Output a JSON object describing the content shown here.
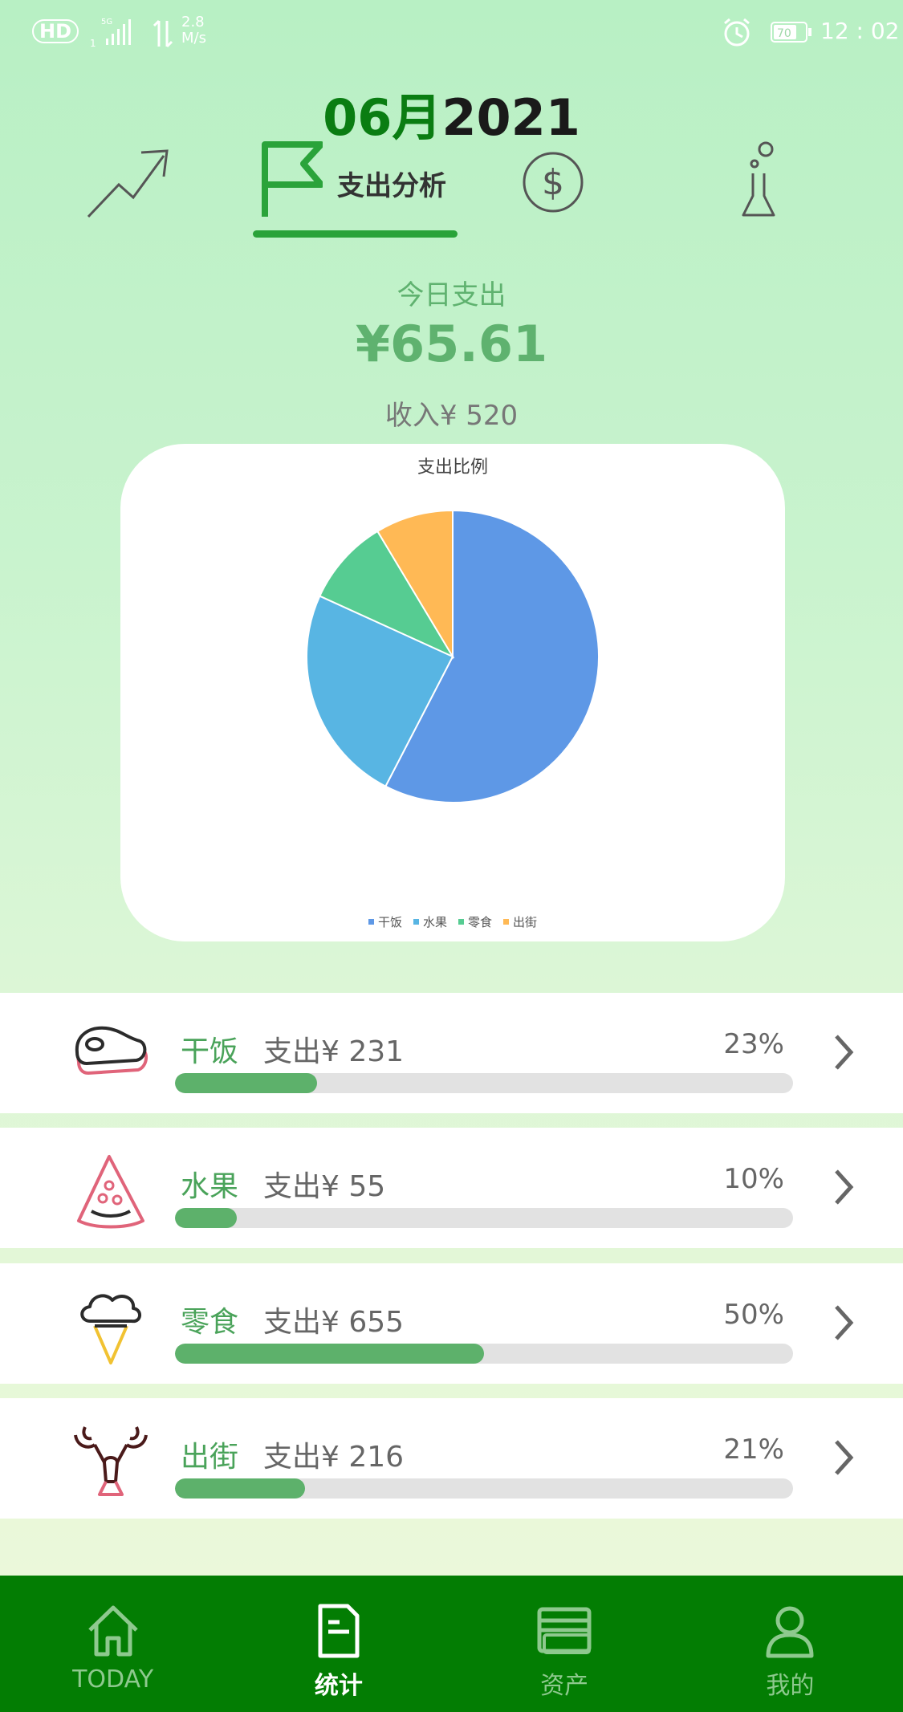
{
  "status_bar": {
    "hd": "HD",
    "sim_slot": "1",
    "net_type": "5G",
    "speed_value": "2.8",
    "speed_unit": "M/s",
    "battery": "70",
    "time": "12 : 02"
  },
  "header": {
    "month": "06月",
    "year": "2021",
    "tabs": [
      {
        "icon": "trend-up-icon"
      },
      {
        "icon": "flag-icon",
        "label": "支出分析",
        "active": true
      },
      {
        "icon": "dollar-coin-icon"
      },
      {
        "icon": "flask-icon"
      }
    ]
  },
  "summary": {
    "today_label": "今日支出",
    "today_amount": "¥65.61",
    "income": "收入¥ 520"
  },
  "chart_data": {
    "type": "pie",
    "title": "支出比例",
    "labels": [
      "干饭",
      "水果",
      "零食",
      "出街"
    ],
    "values": [
      57.6,
      24.2,
      9.6,
      8.6
    ],
    "colors": [
      "#5e98e6",
      "#58b5e3",
      "#56cc92",
      "#ffb955"
    ],
    "legend_position": "bottom-center"
  },
  "categories": [
    {
      "name": "干饭",
      "spend": "支出¥ 231",
      "percent_label": "23%",
      "percent": 23,
      "icon": "steak-icon"
    },
    {
      "name": "水果",
      "spend": "支出¥ 55",
      "percent_label": "10%",
      "percent": 10,
      "icon": "watermelon-icon"
    },
    {
      "name": "零食",
      "spend": "支出¥ 655",
      "percent_label": "50%",
      "percent": 50,
      "icon": "ice-cream-icon"
    },
    {
      "name": "出街",
      "spend": "支出¥ 216",
      "percent_label": "21%",
      "percent": 21,
      "icon": "lobster-icon"
    }
  ],
  "bottom_nav": [
    {
      "label": "TODAY",
      "icon": "home-icon",
      "active": false
    },
    {
      "label": "统计",
      "icon": "document-icon",
      "active": true
    },
    {
      "label": "资产",
      "icon": "wallet-icon",
      "active": false
    },
    {
      "label": "我的",
      "icon": "user-icon",
      "active": false
    }
  ],
  "colors": {
    "accent": "#2aa33a",
    "progress": "#5db16b",
    "nav_bg": "#037d03"
  }
}
